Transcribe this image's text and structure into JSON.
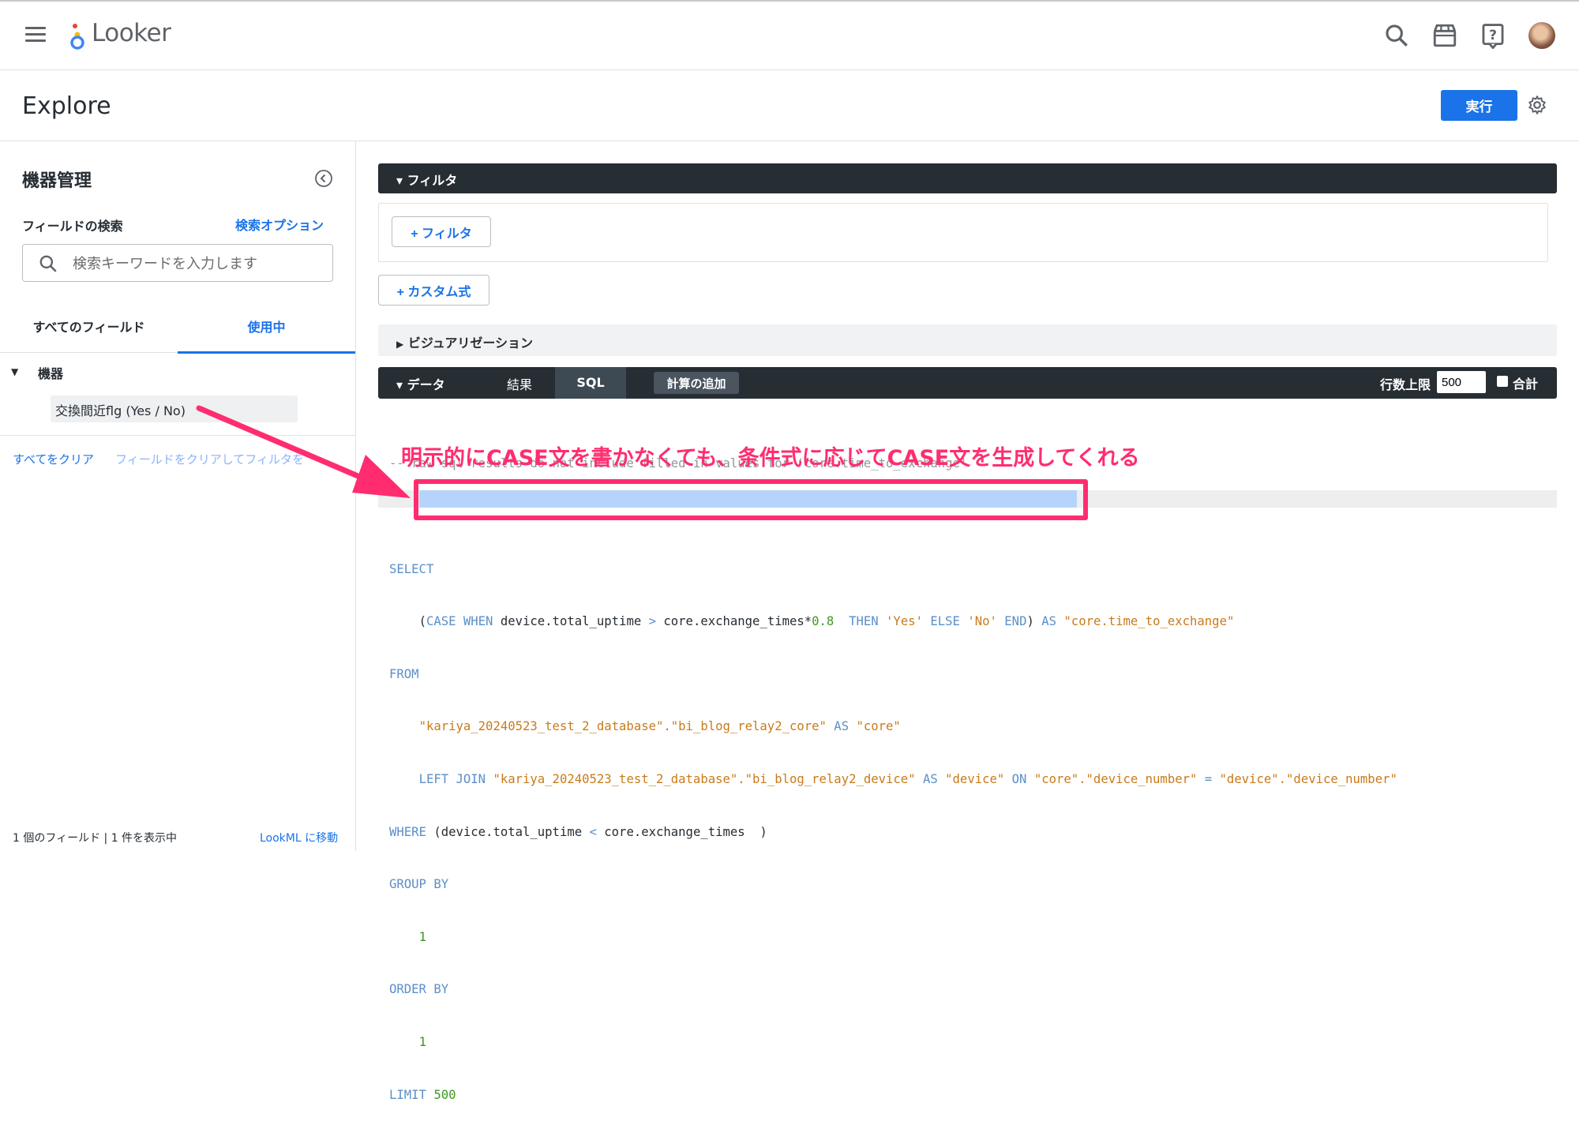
{
  "app": {
    "name": "Looker"
  },
  "page": {
    "title": "Explore",
    "run_label": "実行"
  },
  "sidebar": {
    "title": "機器管理",
    "field_search_label": "フィールドの検索",
    "search_options": "検索オプション",
    "search_placeholder": "検索キーワードを入力します",
    "tabs": [
      "すべてのフィールド",
      "使用中"
    ],
    "active_tab": "使用中",
    "group": "機器",
    "field_item": "交換間近flg (Yes / No)",
    "clear_all": "すべてをクリア",
    "clear_fields": "フィールドをクリアしてフィルタを",
    "status": "1 個のフィールド | 1 件を表示中",
    "lookml_link": "LookML に移動"
  },
  "panels": {
    "filter": "フィルタ",
    "add_filter": "+ フィルタ",
    "add_custom": "+ カスタム式",
    "visualization": "ビジュアリゼーション",
    "data": "データ",
    "tab_results": "結果",
    "tab_sql": "SQL",
    "add_calc": "計算の追加",
    "row_limit_label": "行数上限",
    "row_limit_value": "500",
    "total_label": "合計"
  },
  "annotation": "明示的にCASE文を書かなくても、条件式に応じてCASE文を生成してくれる",
  "sql": {
    "comment": "-- raw sql results do not include filled-in values for 'core.time_to_exchange'",
    "select": "SELECT",
    "case_expr_pre": "(",
    "case_kw": "CASE WHEN",
    "case_field1": " device.total_uptime ",
    "gt": ">",
    "case_field2": " core.exchange_times*",
    "case_num": "0.8",
    "then_kw": "  THEN ",
    "yes": "'Yes'",
    "else_kw": " ELSE ",
    "no": "'No'",
    "end_kw": " END",
    "case_close": ")",
    "as_kw": " AS ",
    "alias": "\"core.time_to_exchange\"",
    "from": "FROM",
    "from_table": "\"kariya_20240523_test_2_database\".\"bi_blog_relay2_core\"",
    "from_as": " AS ",
    "from_alias": "\"core\"",
    "left_join": "LEFT JOIN ",
    "join_table": "\"kariya_20240523_test_2_database\".\"bi_blog_relay2_device\"",
    "join_as": " AS ",
    "join_alias": "\"device\"",
    "on_kw": " ON ",
    "on_left": "\"core\".\"device_number\"",
    "eq": " = ",
    "on_right": "\"device\".\"device_number\"",
    "where": "WHERE",
    "where_expr_a": " (device.total_uptime ",
    "lt": "<",
    "where_expr_b": " core.exchange_times  )",
    "group_by": "GROUP BY",
    "group_val": "1",
    "order_by": "ORDER BY",
    "order_val": "1",
    "limit": "LIMIT",
    "limit_val": "500"
  },
  "colors": {
    "accent": "#1a73e8",
    "annotation": "#ff2d6f",
    "dark_bar": "#262d33"
  },
  "icons": [
    "menu-icon",
    "looker-logo-icon",
    "search-icon",
    "marketplace-icon",
    "help-icon",
    "avatar",
    "settings-gear-icon",
    "collapse-panel-icon"
  ]
}
